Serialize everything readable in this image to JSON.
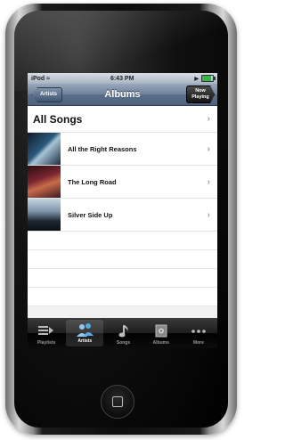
{
  "status": {
    "carrier": "iPod",
    "time": "6:43 PM",
    "battery_level": 0.85
  },
  "nav": {
    "back_label": "Artists",
    "title": "Albums",
    "now_playing_line1": "Now",
    "now_playing_line2": "Playing"
  },
  "list": {
    "all_songs": "All Songs",
    "albums": [
      {
        "name": "All the Right Reasons"
      },
      {
        "name": "The Long Road"
      },
      {
        "name": "Silver Side Up"
      }
    ]
  },
  "tabs": [
    {
      "label": "Playlists",
      "icon": "playlists-icon"
    },
    {
      "label": "Artists",
      "icon": "artists-icon",
      "active": true
    },
    {
      "label": "Songs",
      "icon": "songs-icon"
    },
    {
      "label": "Albums",
      "icon": "albums-icon"
    },
    {
      "label": "More",
      "icon": "more-icon"
    }
  ]
}
